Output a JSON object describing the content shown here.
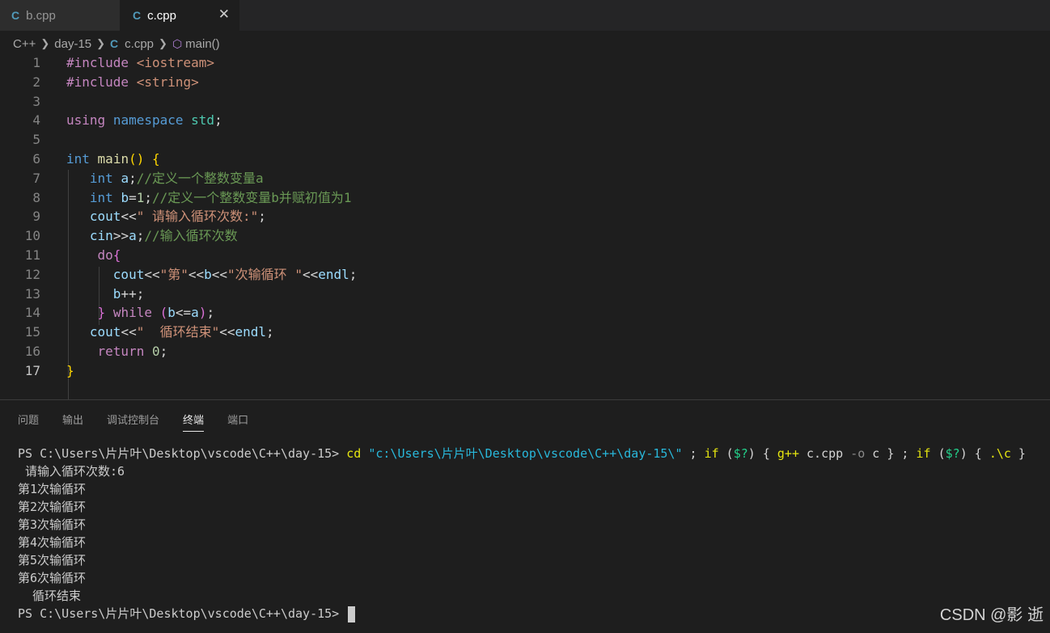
{
  "tabs": [
    {
      "icon": "cpp-file-icon",
      "label": "b.cpp"
    },
    {
      "icon": "cpp-file-icon",
      "label": "c.cpp",
      "close": "✕"
    }
  ],
  "breadcrumb": {
    "lang": "C++",
    "folder": "day-15",
    "file": "c.cpp",
    "symbol": "main()"
  },
  "code_lines": [
    {
      "n": "1",
      "tokens": [
        [
          "kw-pink",
          "#include"
        ],
        [
          "plain",
          " "
        ],
        [
          "str",
          "<iostream>"
        ]
      ]
    },
    {
      "n": "2",
      "tokens": [
        [
          "kw-pink",
          "#include"
        ],
        [
          "plain",
          " "
        ],
        [
          "str",
          "<string>"
        ]
      ]
    },
    {
      "n": "3",
      "tokens": []
    },
    {
      "n": "4",
      "tokens": [
        [
          "kw-pink",
          "using"
        ],
        [
          "plain",
          " "
        ],
        [
          "kw-blue",
          "namespace"
        ],
        [
          "plain",
          " "
        ],
        [
          "type",
          "std"
        ],
        [
          "plain",
          ";"
        ]
      ]
    },
    {
      "n": "5",
      "tokens": []
    },
    {
      "n": "6",
      "tokens": [
        [
          "kw-blue",
          "int"
        ],
        [
          "plain",
          " "
        ],
        [
          "fn",
          "main"
        ],
        [
          "br1",
          "()"
        ],
        [
          "plain",
          " "
        ],
        [
          "br1",
          "{"
        ]
      ]
    },
    {
      "n": "7",
      "tokens": [
        [
          "plain",
          "   "
        ],
        [
          "kw-blue",
          "int"
        ],
        [
          "plain",
          " "
        ],
        [
          "var",
          "a"
        ],
        [
          "plain",
          ";"
        ],
        [
          "cmt",
          "//定义一个整数变量a"
        ]
      ]
    },
    {
      "n": "8",
      "tokens": [
        [
          "plain",
          "   "
        ],
        [
          "kw-blue",
          "int"
        ],
        [
          "plain",
          " "
        ],
        [
          "var",
          "b"
        ],
        [
          "plain",
          "="
        ],
        [
          "num",
          "1"
        ],
        [
          "plain",
          ";"
        ],
        [
          "cmt",
          "//定义一个整数变量b并赋初值为1"
        ]
      ]
    },
    {
      "n": "9",
      "tokens": [
        [
          "plain",
          "   "
        ],
        [
          "var",
          "cout"
        ],
        [
          "plain",
          "<<"
        ],
        [
          "str",
          "\" 请输入循环次数:\""
        ],
        [
          "plain",
          ";"
        ]
      ]
    },
    {
      "n": "10",
      "tokens": [
        [
          "plain",
          "   "
        ],
        [
          "var",
          "cin"
        ],
        [
          "plain",
          ">>"
        ],
        [
          "var",
          "a"
        ],
        [
          "plain",
          ";"
        ],
        [
          "cmt",
          "//输入循环次数"
        ]
      ]
    },
    {
      "n": "11",
      "tokens": [
        [
          "plain",
          "    "
        ],
        [
          "kw-pink",
          "do"
        ],
        [
          "br2",
          "{"
        ]
      ]
    },
    {
      "n": "12",
      "tokens": [
        [
          "plain",
          "      "
        ],
        [
          "var",
          "cout"
        ],
        [
          "plain",
          "<<"
        ],
        [
          "str",
          "\"第\""
        ],
        [
          "plain",
          "<<"
        ],
        [
          "var",
          "b"
        ],
        [
          "plain",
          "<<"
        ],
        [
          "str",
          "\"次输循环 \""
        ],
        [
          "plain",
          "<<"
        ],
        [
          "var",
          "endl"
        ],
        [
          "plain",
          ";"
        ]
      ]
    },
    {
      "n": "13",
      "tokens": [
        [
          "plain",
          "      "
        ],
        [
          "var",
          "b"
        ],
        [
          "plain",
          "++;"
        ]
      ]
    },
    {
      "n": "14",
      "tokens": [
        [
          "plain",
          "    "
        ],
        [
          "br2",
          "}"
        ],
        [
          "plain",
          " "
        ],
        [
          "kw-pink",
          "while"
        ],
        [
          "plain",
          " "
        ],
        [
          "br2",
          "("
        ],
        [
          "var",
          "b"
        ],
        [
          "plain",
          "<="
        ],
        [
          "var",
          "a"
        ],
        [
          "br2",
          ")"
        ],
        [
          "plain",
          ";"
        ]
      ]
    },
    {
      "n": "15",
      "tokens": [
        [
          "plain",
          "   "
        ],
        [
          "var",
          "cout"
        ],
        [
          "plain",
          "<<"
        ],
        [
          "str",
          "\"  循环结束\""
        ],
        [
          "plain",
          "<<"
        ],
        [
          "var",
          "endl"
        ],
        [
          "plain",
          ";"
        ]
      ]
    },
    {
      "n": "16",
      "tokens": [
        [
          "plain",
          "    "
        ],
        [
          "kw-pink",
          "return"
        ],
        [
          "plain",
          " "
        ],
        [
          "num",
          "0"
        ],
        [
          "plain",
          ";"
        ]
      ]
    },
    {
      "n": "17",
      "tokens": [
        [
          "br1",
          "}"
        ]
      ]
    }
  ],
  "panel_tabs": [
    "问题",
    "输出",
    "调试控制台",
    "终端",
    "端口"
  ],
  "active_panel_tab": "终端",
  "terminal": {
    "prompt": "PS C:\\Users\\片片叶\\Desktop\\vscode\\C++\\day-15>",
    "command_tokens": [
      [
        "t-yellow",
        "cd"
      ],
      [
        "plain",
        " "
      ],
      [
        "t-cyan",
        "\"c:\\Users\\片片叶\\Desktop\\vscode\\C++\\day-15\\\""
      ],
      [
        "plain",
        " ; "
      ],
      [
        "t-yellow",
        "if"
      ],
      [
        "plain",
        " ("
      ],
      [
        "t-green",
        "$?"
      ],
      [
        "plain",
        ") { "
      ],
      [
        "t-yellow",
        "g++"
      ],
      [
        "plain",
        " c.cpp "
      ],
      [
        "t-gray",
        "-o"
      ],
      [
        "plain",
        " c } ; "
      ],
      [
        "t-yellow",
        "if"
      ],
      [
        "plain",
        " ("
      ],
      [
        "t-green",
        "$?"
      ],
      [
        "plain",
        ") { "
      ],
      [
        "t-yellow",
        ".\\c"
      ],
      [
        "plain",
        " }"
      ]
    ],
    "output": [
      " 请输入循环次数:6",
      "第1次输循环",
      "第2次输循环",
      "第3次输循环",
      "第4次输循环",
      "第5次输循环",
      "第6次输循环",
      "  循环结束"
    ],
    "final_prompt": "PS C:\\Users\\片片叶\\Desktop\\vscode\\C++\\day-15>"
  },
  "watermark": "CSDN @影 逝"
}
